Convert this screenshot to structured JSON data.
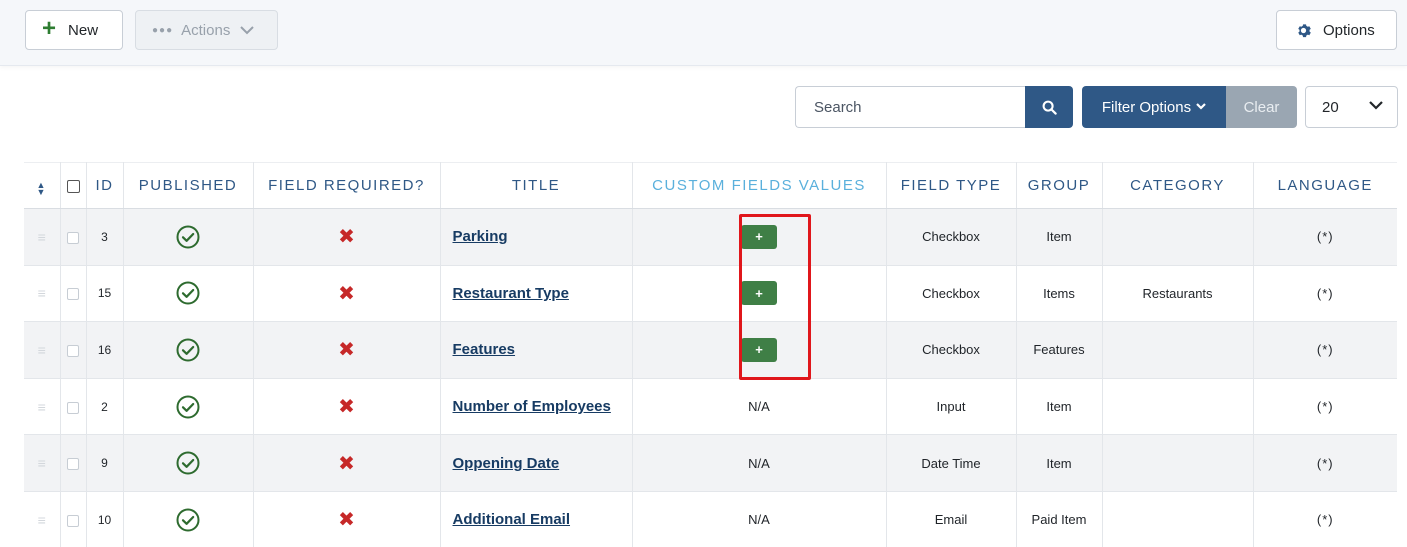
{
  "toolbar": {
    "new_label": "New",
    "actions_label": "Actions",
    "options_label": "Options"
  },
  "filters": {
    "search_placeholder": "Search",
    "filter_options_label": "Filter Options",
    "clear_label": "Clear",
    "limit_value": "20"
  },
  "table": {
    "headers": {
      "id": "ID",
      "published": "PUBLISHED",
      "field_required": "FIELD REQUIRED?",
      "title": "TITLE",
      "custom_fields_values": "CUSTOM FIELDS VALUES",
      "field_type": "FIELD TYPE",
      "group": "GROUP",
      "category": "CATEGORY",
      "language": "LANGUAGE"
    },
    "rows": [
      {
        "id": "3",
        "title": "Parking",
        "custom_values": "+",
        "field_type": "Checkbox",
        "group": "Item",
        "category": "",
        "language": "(*)"
      },
      {
        "id": "15",
        "title": "Restaurant Type",
        "custom_values": "+",
        "field_type": "Checkbox",
        "group": "Items",
        "category": "Restaurants",
        "language": "(*)"
      },
      {
        "id": "16",
        "title": "Features",
        "custom_values": "+",
        "field_type": "Checkbox",
        "group": "Features",
        "category": "",
        "language": "(*)"
      },
      {
        "id": "2",
        "title": "Number of Employees",
        "custom_values": "N/A",
        "field_type": "Input",
        "group": "Item",
        "category": "",
        "language": "(*)"
      },
      {
        "id": "9",
        "title": "Oppening Date",
        "custom_values": "N/A",
        "field_type": "Date Time",
        "group": "Item",
        "category": "",
        "language": "(*)"
      },
      {
        "id": "10",
        "title": "Additional Email",
        "custom_values": "N/A",
        "field_type": "Email",
        "group": "Paid Item",
        "category": "",
        "language": "(*)"
      }
    ]
  },
  "colors": {
    "primary": "#2f5886",
    "success": "#3f7f46",
    "danger": "#c62828",
    "highlight_box": "#e0161b"
  }
}
